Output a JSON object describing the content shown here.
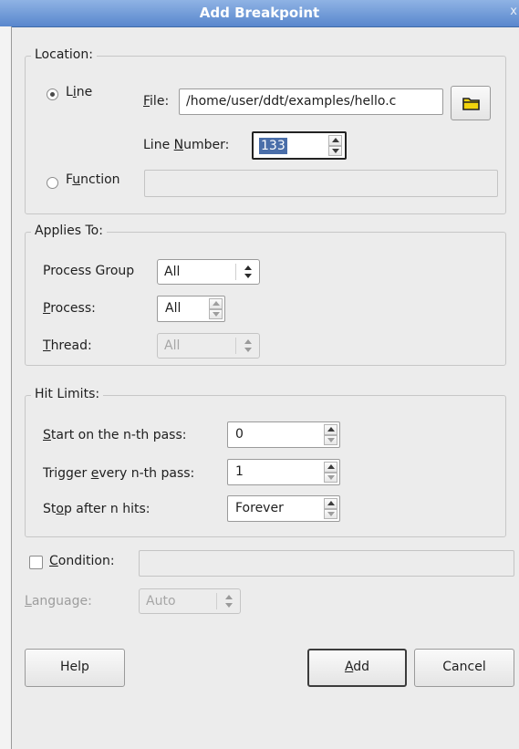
{
  "window": {
    "title": "Add Breakpoint",
    "close_glyph": "x"
  },
  "location": {
    "group_title": "Location:",
    "line_radio": {
      "pre": "L",
      "ul": "i",
      "post": "ne",
      "checked": true
    },
    "file_label": {
      "pre": "",
      "ul": "F",
      "post": "ile:"
    },
    "file_value": "/home/user/ddt/examples/hello.c",
    "browse_icon": "folder-icon",
    "line_number_label": {
      "pre": "Line ",
      "ul": "N",
      "post": "umber:"
    },
    "line_number_value": "133",
    "function_radio": {
      "pre": "F",
      "ul": "u",
      "post": "nction",
      "checked": false
    },
    "function_value": ""
  },
  "applies_to": {
    "group_title": "Applies To:",
    "process_group_label": "Process Group",
    "process_group_value": "All",
    "process_label": {
      "pre": "",
      "ul": "P",
      "post": "rocess:"
    },
    "process_value": "All",
    "thread_label": {
      "pre": "",
      "ul": "T",
      "post": "hread:"
    },
    "thread_value": "All"
  },
  "hit_limits": {
    "group_title": "Hit Limits:",
    "start_label": {
      "pre": "",
      "ul": "S",
      "post": "tart on the n-th pass:"
    },
    "start_value": "0",
    "trigger_label": {
      "pre": "Trigger ",
      "ul": "e",
      "post": "very n-th pass:"
    },
    "trigger_value": "1",
    "stop_label": {
      "pre": "St",
      "ul": "o",
      "post": "p after n hits:"
    },
    "stop_value": "Forever"
  },
  "condition": {
    "label": {
      "pre": "",
      "ul": "C",
      "post": "ondition:"
    },
    "checked": false,
    "value": ""
  },
  "language": {
    "label": {
      "pre": "",
      "ul": "L",
      "post": "anguage:"
    },
    "value": "Auto"
  },
  "buttons": {
    "help": "Help",
    "add": {
      "pre": "",
      "ul": "A",
      "post": "dd"
    },
    "cancel": "Cancel"
  },
  "colors": {
    "titlebar": "#5987cd",
    "selection": "#4a6ea9"
  }
}
